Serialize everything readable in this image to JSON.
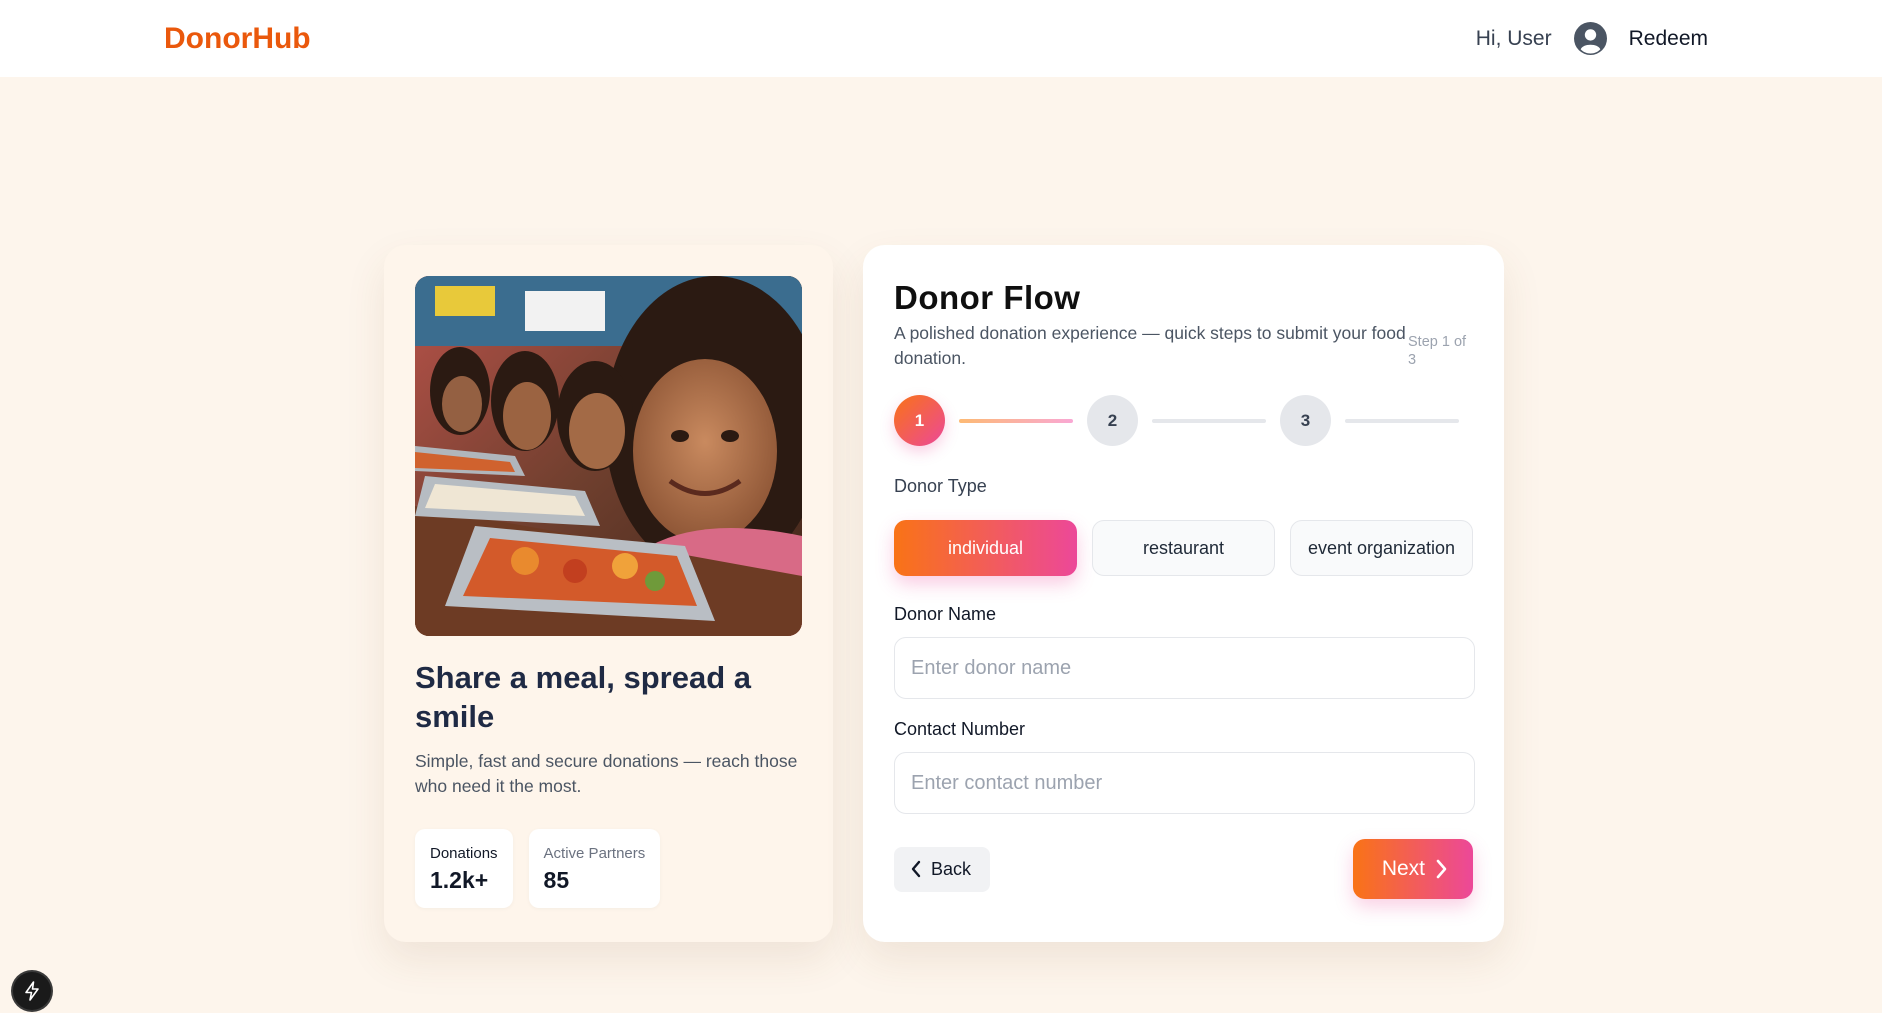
{
  "header": {
    "brand": "DonorHub",
    "greeting": "Hi, User",
    "avatar_icon": "user-circle-icon",
    "redeem_label": "Redeem"
  },
  "promo": {
    "image_icon": "children-meal-photo",
    "title": "Share a meal, spread a smile",
    "description": "Simple, fast and secure donations — reach those who need it the most.",
    "stats": [
      {
        "label": "Donations",
        "value": "1.2k+"
      },
      {
        "label": "Active Partners",
        "value": "85"
      }
    ]
  },
  "flow": {
    "title": "Donor Flow",
    "subtitle": "A polished donation experience — quick steps to submit your food donation.",
    "step_indicator": "Step 1 of 3",
    "steps": [
      "1",
      "2",
      "3"
    ],
    "current_step": 1,
    "donor_type": {
      "label": "Donor Type",
      "options": [
        "individual",
        "restaurant",
        "event organization"
      ],
      "selected": "individual"
    },
    "donor_name": {
      "label": "Donor Name",
      "placeholder": "Enter donor name",
      "value": ""
    },
    "contact_number": {
      "label": "Contact Number",
      "placeholder": "Enter contact number",
      "value": ""
    },
    "back_label": "Back",
    "next_label": "Next",
    "back_icon": "chevron-left-icon",
    "next_icon": "chevron-right-icon"
  },
  "colors": {
    "brand": "#ea580c",
    "accent_start": "#f97316",
    "accent_end": "#ec4899",
    "page_bg": "#fdf5ec"
  },
  "floating_icon": "lightning-icon"
}
